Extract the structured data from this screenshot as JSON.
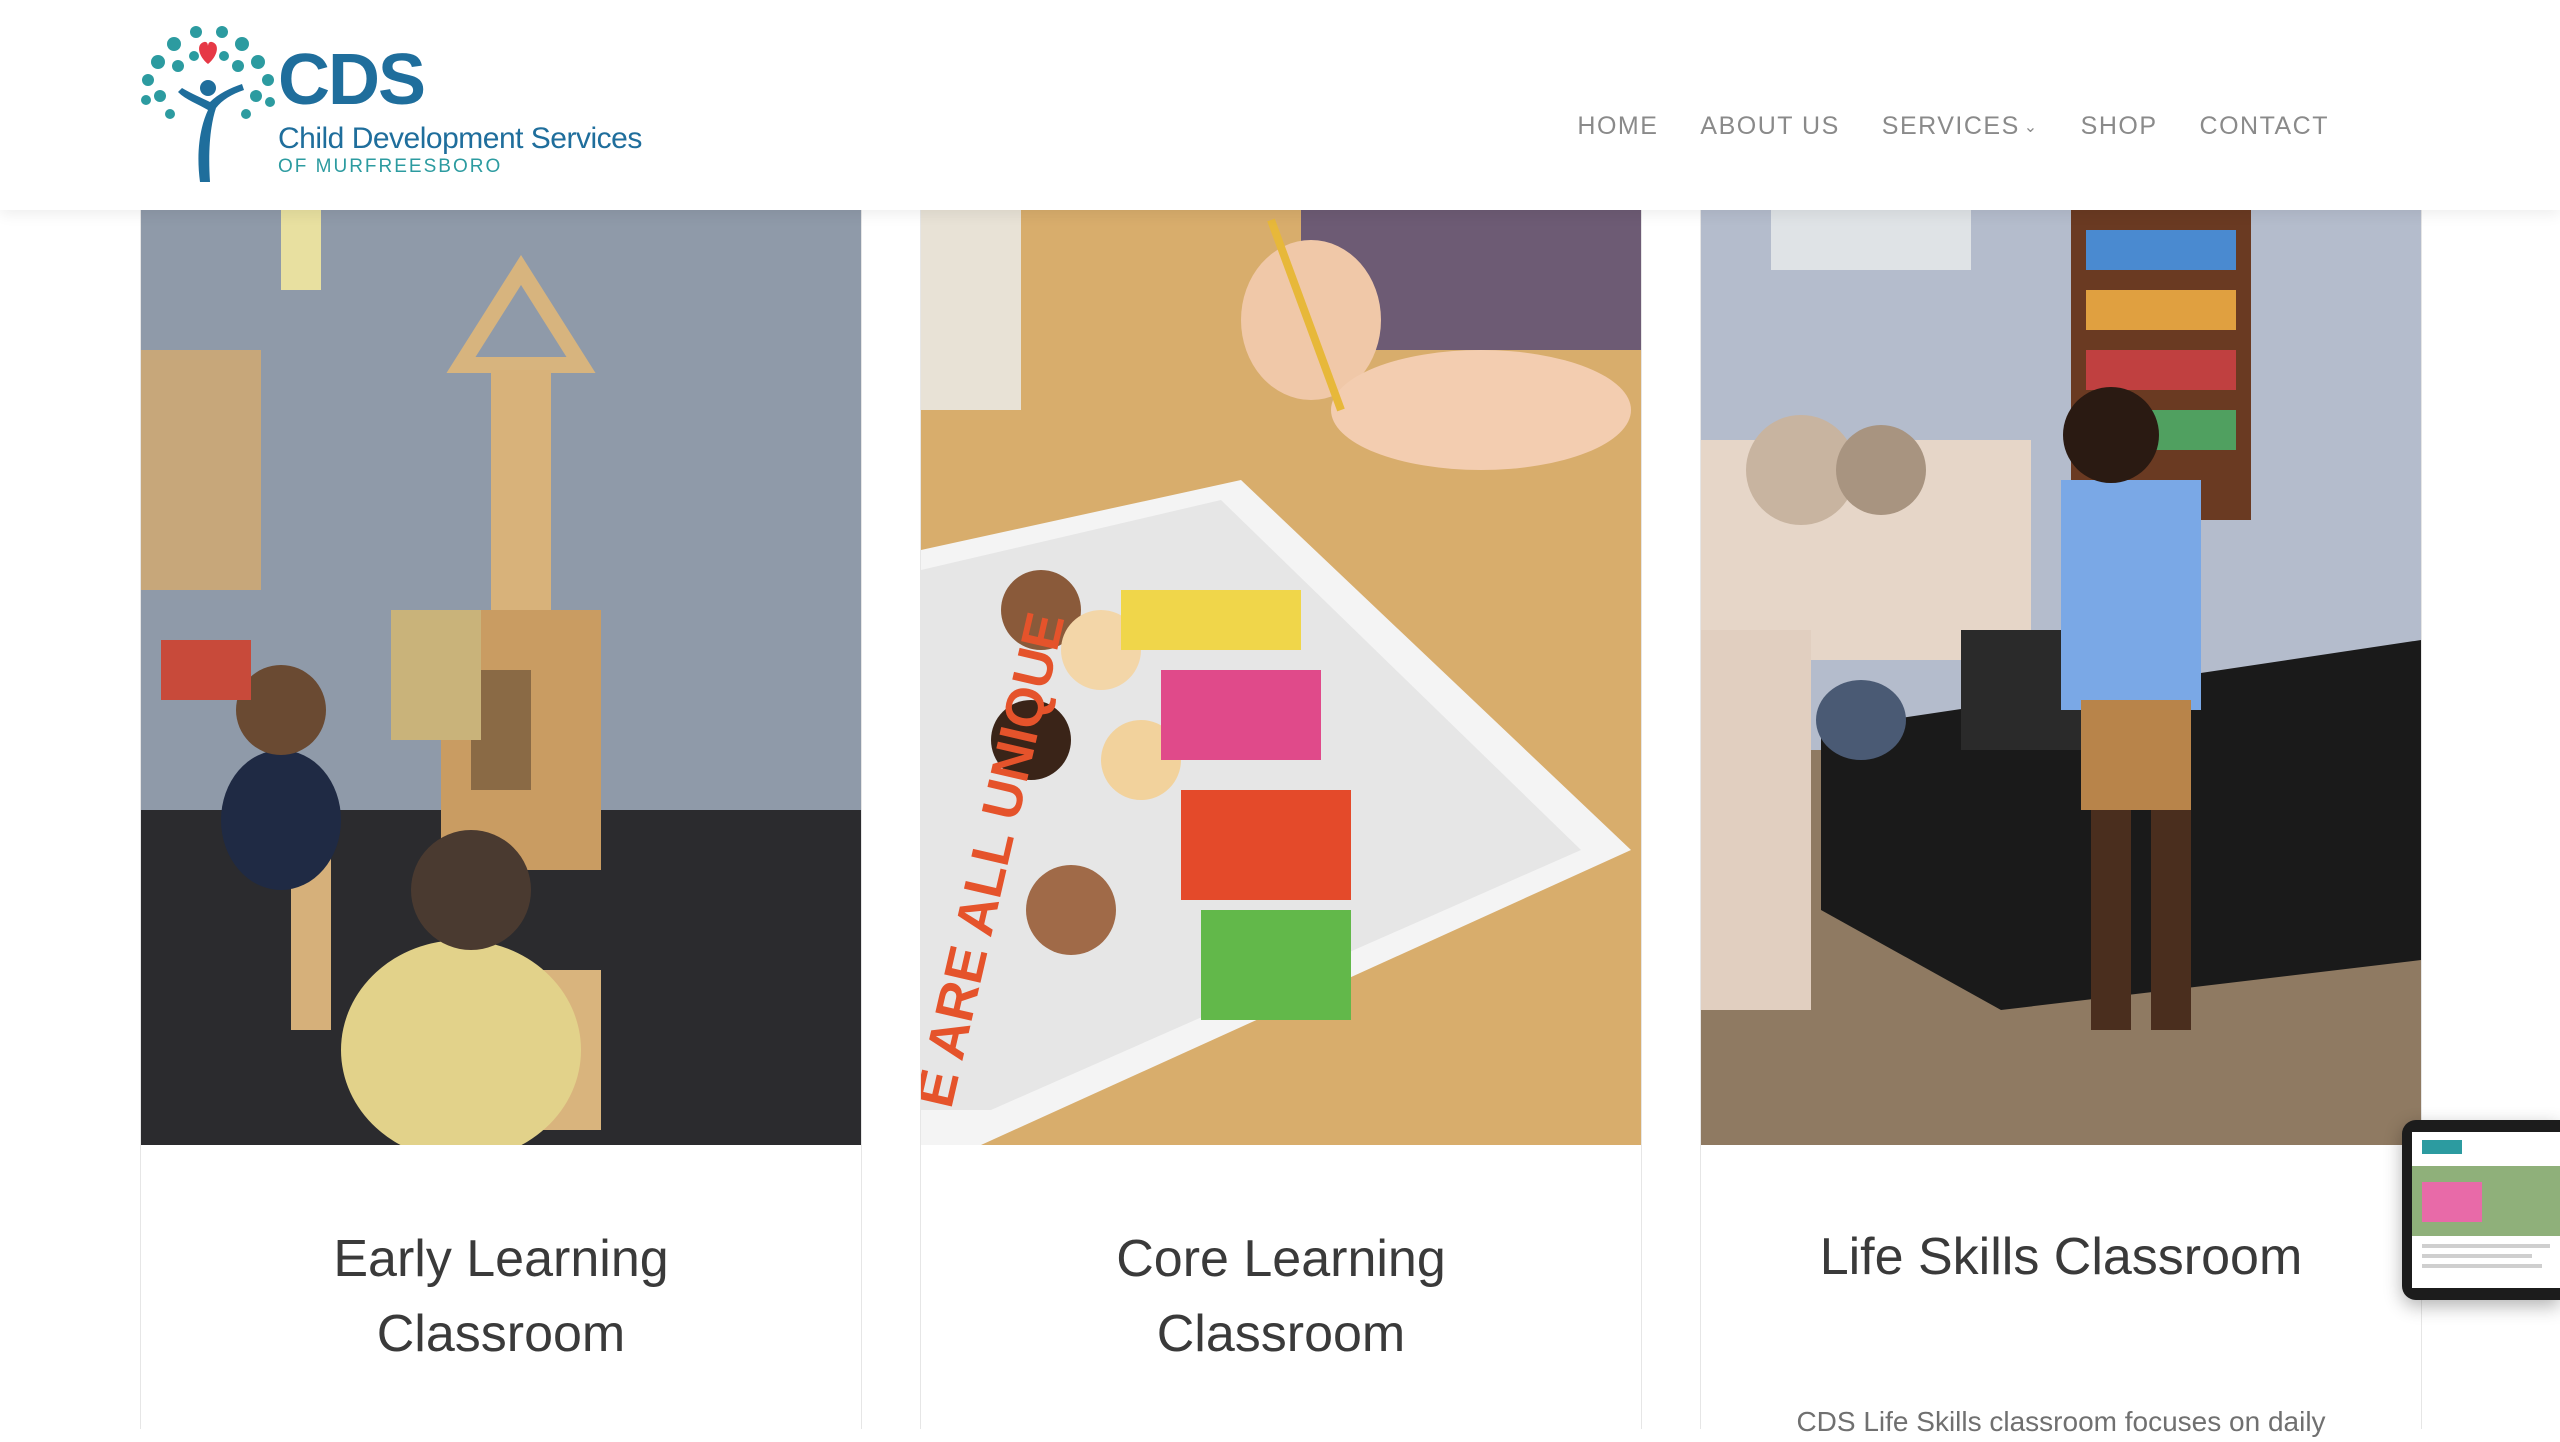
{
  "brand": {
    "name": "CDS",
    "subtitle": "Child Development Services",
    "subtitle2": "OF MURFREESBORO"
  },
  "nav": {
    "items": [
      {
        "label": "HOME"
      },
      {
        "label": "ABOUT US"
      },
      {
        "label": "SERVICES",
        "has_dropdown": true
      },
      {
        "label": "SHOP"
      },
      {
        "label": "CONTACT"
      }
    ]
  },
  "cards": [
    {
      "title_line1": "Early Learning",
      "title_line2": "Classroom",
      "photo": "children building with wooden blocks",
      "description": ""
    },
    {
      "title_line1": "Core Learning",
      "title_line2": "Classroom",
      "photo": "child drawing next to book 'We Are All Unique'",
      "description": ""
    },
    {
      "title_line1": "Life Skills Classroom",
      "title_line2": "",
      "photo": "boy in living room with vacuum",
      "description": "CDS Life Skills classroom focuses on daily"
    }
  ],
  "colors": {
    "brand_blue": "#1f6e9c",
    "brand_teal": "#2c9ba0",
    "heart_red": "#e63946",
    "nav_text": "#8a8a8a"
  }
}
